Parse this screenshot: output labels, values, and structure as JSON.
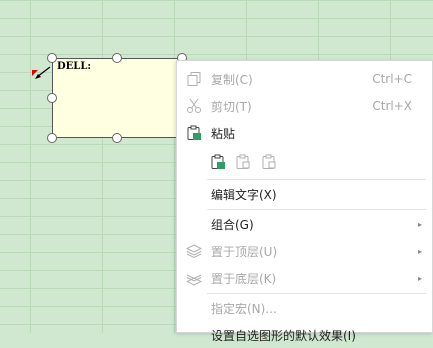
{
  "comment": {
    "text": "DELL:"
  },
  "menu": {
    "copy": {
      "label": "复制(C)",
      "shortcut": "Ctrl+C"
    },
    "cut": {
      "label": "剪切(T)",
      "shortcut": "Ctrl+X"
    },
    "paste": {
      "label": "粘贴"
    },
    "paste_options": [
      "paste-keep-format-icon",
      "paste-values-icon",
      "paste-text-icon"
    ],
    "edit_text": {
      "label": "编辑文字(X)"
    },
    "group": {
      "label": "组合(G)"
    },
    "bring_front": {
      "label": "置于顶层(U)"
    },
    "send_back": {
      "label": "置于底层(K)"
    },
    "assign_macro": {
      "label": "指定宏(N)..."
    },
    "set_default": {
      "label": "设置自选图形的默认效果(I)"
    }
  },
  "colors": {
    "grid_bg": "#cfe8cf",
    "comment_bg": "#ffffe1",
    "accent": "#2f9e63"
  }
}
